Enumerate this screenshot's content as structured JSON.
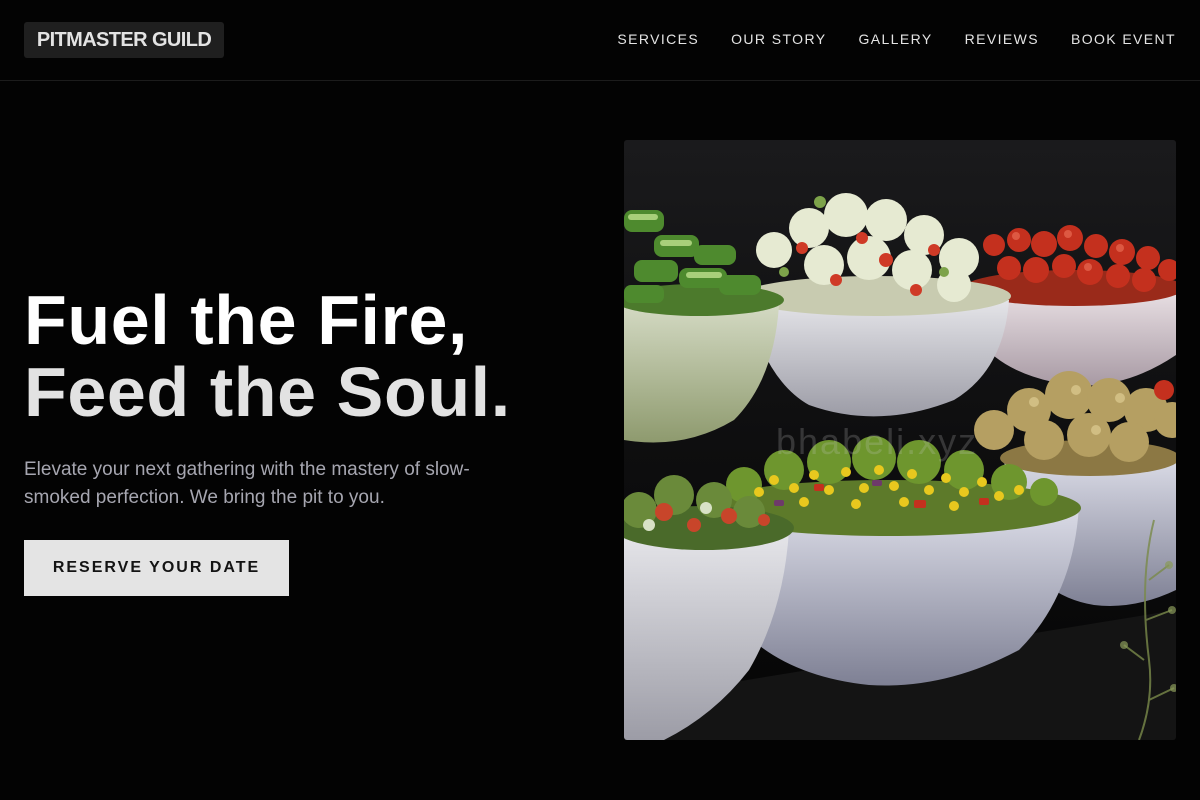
{
  "brand": {
    "name": "PITMASTER GUILD"
  },
  "nav": {
    "items": [
      {
        "label": "SERVICES"
      },
      {
        "label": "OUR STORY"
      },
      {
        "label": "GALLERY"
      },
      {
        "label": "REVIEWS"
      },
      {
        "label": "BOOK EVENT"
      }
    ]
  },
  "hero": {
    "headline_line1": "Fuel the Fire,",
    "headline_line2": "Feed the Soul.",
    "subtext": "Elevate your next gathering with the mastery of slow-smoked perfection. We bring the pit to you.",
    "cta_label": "RESERVE YOUR DATE",
    "image": {
      "subject": "salad-bowls-buffet",
      "watermark": "bhabeli.xyz"
    }
  },
  "colors": {
    "background": "#030303",
    "logo_bg": "#1f1f1f",
    "cta_bg": "#e4e4e4",
    "subtext": "#a6a6b0"
  }
}
